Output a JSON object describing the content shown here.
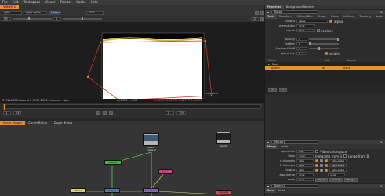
{
  "menubar": [
    "File",
    "Edit",
    "Workspace",
    "Viewer",
    "Render",
    "Cache",
    "Help"
  ],
  "viewer": {
    "tabs": [
      "Viewer1"
    ],
    "channel": "rgba",
    "channel2": "rgba.alpha",
    "input": "Default",
    "gain": "f/8",
    "gamma": "1",
    "zoom": "50%",
    "frame": "1",
    "format_label": "2K",
    "info_left": "3992x2676  bbox: 0 0 3992 2676  channels: rgba",
    "info_mid": "x=1432 y=618",
    "info_right": "0.31373  0.31373  0.31373  0.00000",
    "corner_label": "3992,2676"
  },
  "timeline": {
    "start": "1",
    "end": "100",
    "fps": "24*",
    "frame": "1"
  },
  "properties": {
    "tabs": [
      "Properties",
      "Background Renders"
    ],
    "node_title": "Roto1",
    "subtabs": [
      "Tools",
      "Transform",
      "Motion Blur",
      "Shape",
      "Clone",
      "Lifetime",
      "Tracking",
      "Node"
    ],
    "rows": [
      {
        "label": "output",
        "value": "alpha",
        "extra": "alpha"
      },
      {
        "label": "premultiply",
        "value": "none",
        "extra": ""
      },
      {
        "label": "clip to",
        "value": "bbox",
        "extra": "replace"
      },
      {
        "label": "opacity",
        "value": "1",
        "extra": ""
      },
      {
        "label": "feather",
        "value": "0",
        "extra": ""
      },
      {
        "label": "feather falloff",
        "value": "1",
        "extra": ""
      },
      {
        "label": "spline key",
        "value": "0",
        "extra": "visible"
      }
    ],
    "layers_header": [
      "Name",
      "Life",
      "Source"
    ],
    "layers": [
      {
        "name": "Root",
        "life": "",
        "source": ""
      },
      {
        "name": "Bezier1",
        "life": "all",
        "source": "none"
      }
    ]
  },
  "merge": {
    "tabs": [
      "Merge"
    ],
    "subtabs": [
      "Merge",
      "Node"
    ],
    "node_title": "Merge1",
    "rows": [
      {
        "label": "operation",
        "value": "over",
        "extra": "Video colorspace"
      },
      {
        "label": "bbox",
        "value": "union",
        "extra": "metadata from B"
      },
      {
        "label": "A channels",
        "value": "rgba",
        "extra": "rgba.alpha"
      },
      {
        "label": "B channels",
        "value": "rgba",
        "extra": "rgba.alpha"
      },
      {
        "label": "output",
        "value": "rgba",
        "extra": "rgba.alpha"
      },
      {
        "label": "also merge",
        "value": "none",
        "extra": "none"
      },
      {
        "label": "mask",
        "value": "none",
        "extra": ""
      },
      {
        "label": "mix",
        "value": "1",
        "extra": ""
      }
    ],
    "range_label": "range from B",
    "buttons": [
      "inject",
      "invert",
      "fringe"
    ]
  },
  "bottom_panel": {
    "node_title": "Bezier1",
    "subtabs": [
      "Roto",
      "Node"
    ]
  },
  "node_graph": {
    "tabs": [
      "Node Graph",
      "Curve Editor",
      "Dope Sheet"
    ],
    "nodes": {
      "read1": "Read1",
      "read1_sub": "Image.tif",
      "read2": "Read2",
      "grade": "Grade1",
      "blur": "Blur1",
      "roto": "Roto1",
      "merge": "Merge1",
      "viewer": "Viewer1",
      "transform": "Transform1"
    }
  },
  "colors": {
    "accent": "#ee8c2a",
    "roto_node": "#8fc4e6",
    "merge_node": "#5a7aa8",
    "grade_node": "#2fbf3a",
    "blur_node": "#d04a8a",
    "read_node": "#b5b5b5",
    "selected_layer": "#e8962a"
  }
}
